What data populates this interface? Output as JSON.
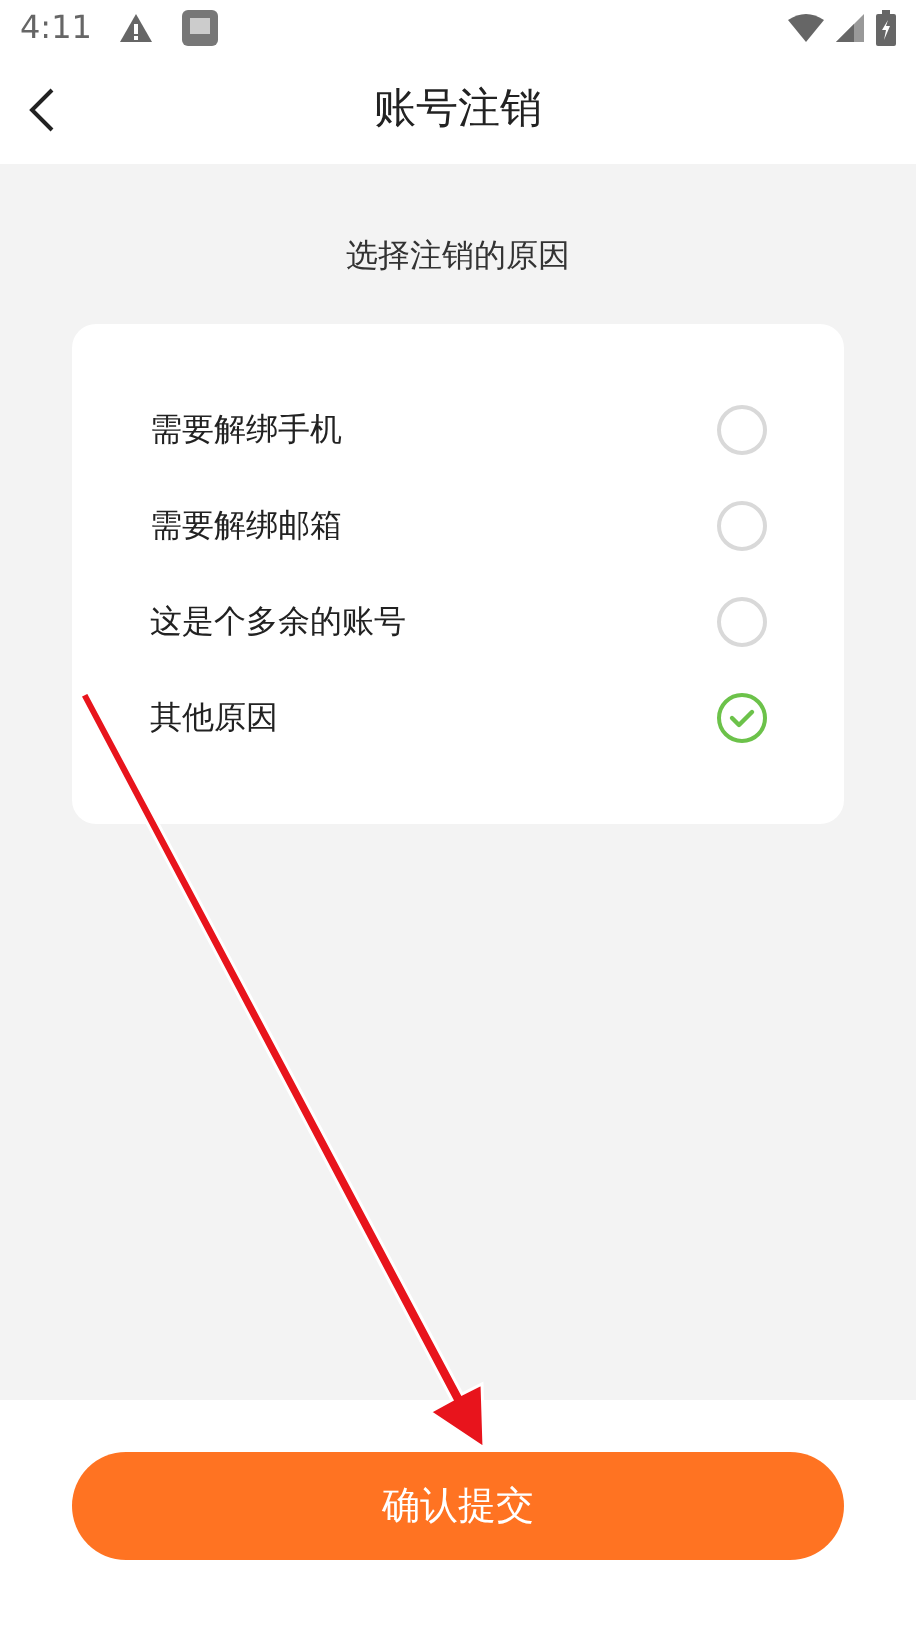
{
  "status_bar": {
    "time": "4:11"
  },
  "header": {
    "title": "账号注销"
  },
  "section_title": "选择注销的原因",
  "reasons": [
    {
      "label": "需要解绑手机",
      "selected": false
    },
    {
      "label": "需要解绑邮箱",
      "selected": false
    },
    {
      "label": "这是个多余的账号",
      "selected": false
    },
    {
      "label": "其他原因",
      "selected": true
    }
  ],
  "submit_button": "确认提交"
}
